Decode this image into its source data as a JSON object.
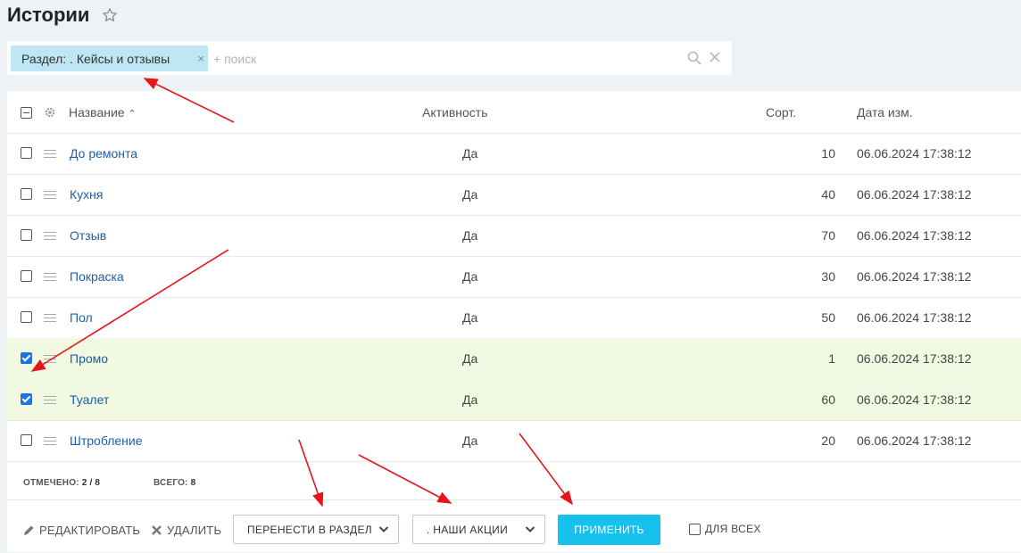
{
  "page": {
    "title": "Истории"
  },
  "filter": {
    "chip_label": "Раздел: . Кейсы и отзывы",
    "chip_close": "×",
    "search_placeholder": "+ поиск"
  },
  "columns": {
    "name": "Название",
    "name_sort": "⌃",
    "active": "Активность",
    "sort": "Сорт.",
    "date": "Дата изм."
  },
  "rows": [
    {
      "name": "До ремонта",
      "active": "Да",
      "sort": "10",
      "date": "06.06.2024 17:38:12",
      "checked": false
    },
    {
      "name": "Кухня",
      "active": "Да",
      "sort": "40",
      "date": "06.06.2024 17:38:12",
      "checked": false
    },
    {
      "name": "Отзыв",
      "active": "Да",
      "sort": "70",
      "date": "06.06.2024 17:38:12",
      "checked": false
    },
    {
      "name": "Покраска",
      "active": "Да",
      "sort": "30",
      "date": "06.06.2024 17:38:12",
      "checked": false
    },
    {
      "name": "Пол",
      "active": "Да",
      "sort": "50",
      "date": "06.06.2024 17:38:12",
      "checked": false
    },
    {
      "name": "Промо",
      "active": "Да",
      "sort": "1",
      "date": "06.06.2024 17:38:12",
      "checked": true
    },
    {
      "name": "Туалет",
      "active": "Да",
      "sort": "60",
      "date": "06.06.2024 17:38:12",
      "checked": true
    },
    {
      "name": "Штробление",
      "active": "Да",
      "sort": "20",
      "date": "06.06.2024 17:38:12",
      "checked": false
    }
  ],
  "summary": {
    "selected_label": "ОТМЕЧЕНО:",
    "selected_value": "2 / 8",
    "total_label": "ВСЕГО:",
    "total_value": "8"
  },
  "toolbar": {
    "edit": "РЕДАКТИРОВАТЬ",
    "delete": "УДАЛИТЬ",
    "action_select": "ПЕРЕНЕСТИ В РАЗДЕЛ",
    "section_select": ". НАШИ АКЦИИ",
    "apply": "ПРИМЕНИТЬ",
    "for_all": "ДЛЯ ВСЕХ"
  },
  "colors": {
    "accent": "#17c1ee",
    "link": "#1e5da8",
    "selected_row": "#f2f9e3",
    "chip": "#bfe6f5",
    "annotation_arrow": "#e8141b"
  },
  "icons": [
    "star-icon",
    "close-icon",
    "search-icon",
    "gear-icon",
    "drag-handle-icon",
    "pencil-icon",
    "cross-icon",
    "chevron-down-icon"
  ]
}
